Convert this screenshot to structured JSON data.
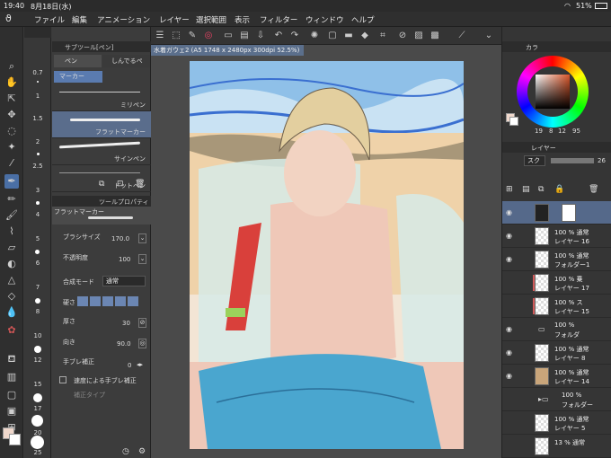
{
  "status": {
    "time": "19:40",
    "date": "8月18日(水)",
    "battery": "51%"
  },
  "menu": [
    "ファイル",
    "編集",
    "アニメーション",
    "レイヤー",
    "選択範囲",
    "表示",
    "フィルター",
    "ウィンドウ",
    "ヘルプ"
  ],
  "size_labels": [
    "0.7",
    "1",
    "1.5",
    "2",
    "2.5",
    "3",
    "4",
    "5",
    "6",
    "7",
    "8",
    "10",
    "12",
    "15",
    "17",
    "20",
    "25"
  ],
  "subtool": {
    "header": "サブツール[ペン]",
    "tabs": [
      "ペン",
      "しんでるペ"
    ],
    "group": "マーカー",
    "items": [
      "ミリペン",
      "フラットマーカー",
      "サインペン",
      "ドットペン"
    ],
    "selected_index": 1
  },
  "toolprop": {
    "header": "ツールプロパティ",
    "brush_name": "フラットマーカー",
    "brush_size_label": "ブラシサイズ",
    "brush_size_value": "170.0",
    "opacity_label": "不透明度",
    "opacity_value": "100",
    "blend_label": "合成モード",
    "blend_value": "通常",
    "hardness_label": "硬さ",
    "thickness_label": "厚さ",
    "thickness_value": "30",
    "direction_label": "向き",
    "direction_value": "90.0",
    "stabilizer_label": "手ブレ補正",
    "stabilizer_value": "0",
    "speed_stab_label": "速度による手ブレ補正",
    "stab_type_label": "補正タイプ"
  },
  "document": {
    "tab_title": "水着ガウェ2 (A5 1748 x 2480px 300dpi 52.5%)"
  },
  "color": {
    "header": "カラ",
    "values": [
      "19",
      "8",
      "12",
      "95"
    ],
    "accent": "#d9562a"
  },
  "layers": {
    "header": "レイヤー",
    "blend_short": "スク",
    "opacity_value": "26",
    "items": [
      {
        "line1": "",
        "line2": ""
      },
      {
        "line1": "100 % 通常",
        "line2": "レイヤー 16"
      },
      {
        "line1": "100 % 通常",
        "line2": "フォルダー1"
      },
      {
        "line1": "100 % 乗",
        "line2": "レイヤー 17"
      },
      {
        "line1": "100 % ス",
        "line2": "レイヤー 15"
      },
      {
        "line1": "100 %",
        "line2": "フォルダ"
      },
      {
        "line1": "100 % 通常",
        "line2": "レイヤー 8"
      },
      {
        "line1": "100 % 通常",
        "line2": "レイヤー 14"
      },
      {
        "line1": "100 %",
        "line2": "フォルダー"
      },
      {
        "line1": "100 % 通常",
        "line2": "レイヤー 5"
      },
      {
        "line1": "13 % 通常",
        "line2": ""
      }
    ]
  }
}
